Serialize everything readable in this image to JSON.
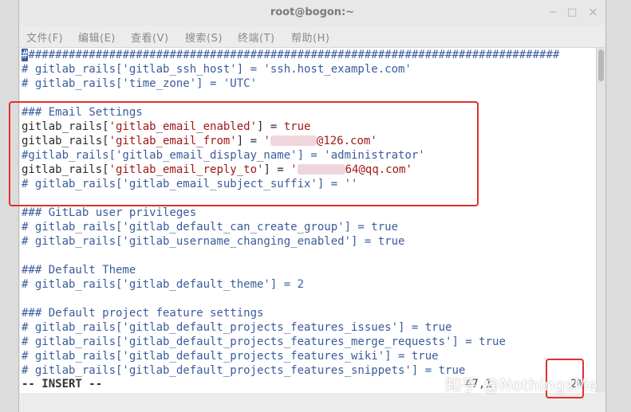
{
  "window": {
    "title": "root@bogon:~",
    "controls": {
      "minimize": "−",
      "maximize": "□",
      "close": "×"
    }
  },
  "menu": [
    "文件(F)",
    "编辑(E)",
    "查看(V)",
    "搜索(S)",
    "终端(T)",
    "帮助(H)"
  ],
  "editor": {
    "lines": [
      "################################################################################",
      "# gitlab_rails['gitlab_ssh_host'] = 'ssh.host_example.com'",
      "# gitlab_rails['time_zone'] = 'UTC'",
      "",
      "### Email Settings",
      "gitlab_rails['gitlab_email_enabled'] = true",
      "gitlab_rails['gitlab_email_from'] = '@126.com'",
      "#gitlab_rails['gitlab_email_display_name'] = 'administrator'",
      "gitlab_rails['gitlab_email_reply_to'] = '64@qq.com'",
      "# gitlab_rails['gitlab_email_subject_suffix'] = ''",
      "",
      "### GitLab user privileges",
      "# gitlab_rails['gitlab_default_can_create_group'] = true",
      "# gitlab_rails['gitlab_username_changing_enabled'] = true",
      "",
      "### Default Theme",
      "# gitlab_rails['gitlab_default_theme'] = 2",
      "",
      "### Default project feature settings",
      "# gitlab_rails['gitlab_default_projects_features_issues'] = true",
      "# gitlab_rails['gitlab_default_projects_features_merge_requests'] = true",
      "# gitlab_rails['gitlab_default_projects_features_wiki'] = true",
      "# gitlab_rails['gitlab_default_projects_features_snippets'] = true"
    ],
    "line1_rest": "###############################################################################",
    "cursor_char": "#",
    "email_from_suffix": "@126.com",
    "reply_to_suffix": "64@qq.com"
  },
  "status": {
    "mode": "-- INSERT --",
    "position": "47,1",
    "percent": "2%"
  },
  "watermark": "知乎 @NothingsMe",
  "colors": {
    "comment": "#3a5c9c",
    "string": "#a01818",
    "keyword": "#a01818",
    "highlight_box": "#e03030"
  }
}
